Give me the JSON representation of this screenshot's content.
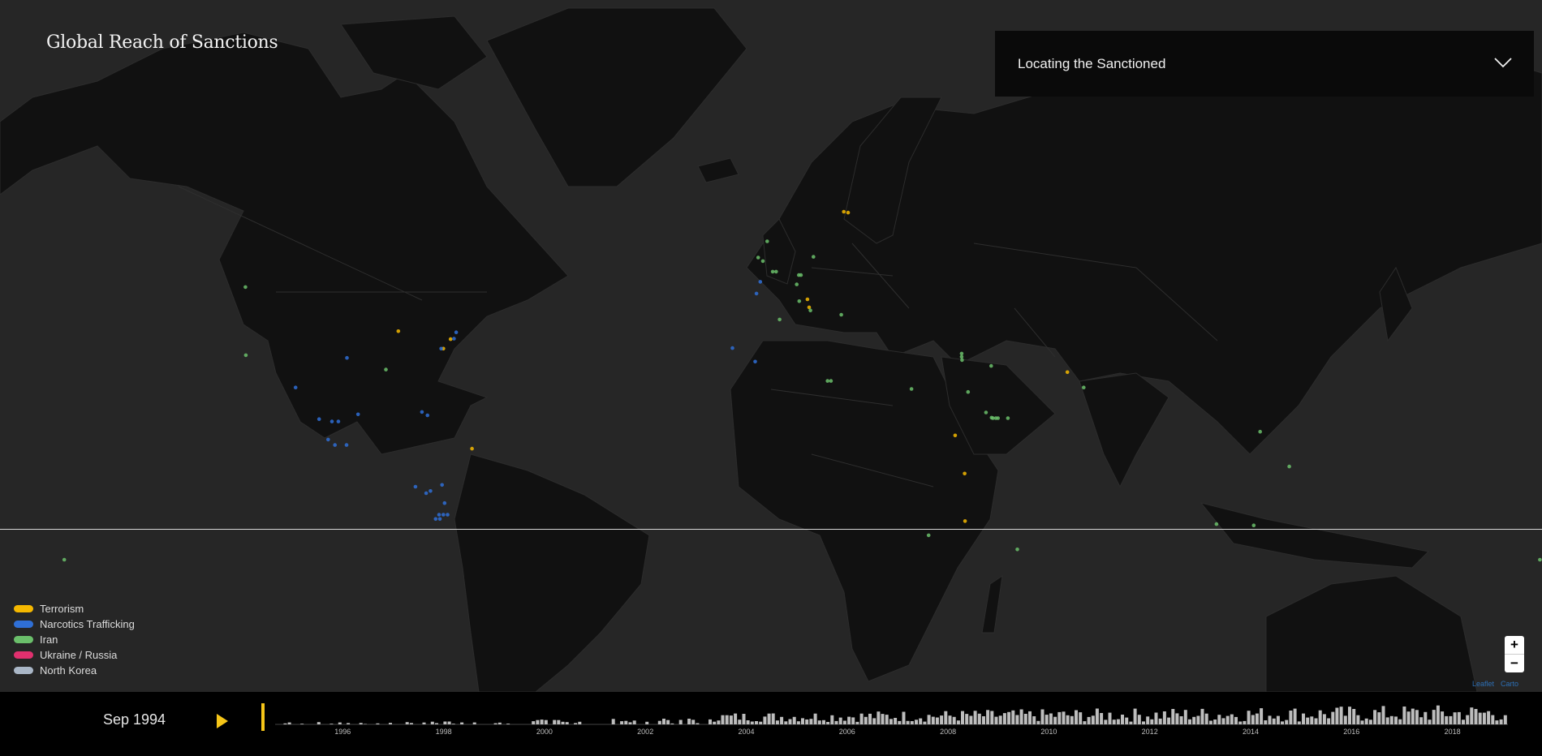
{
  "app": {
    "title": "Global Reach of Sanctions",
    "dropdown_label": "Locating the Sanctioned"
  },
  "legend": [
    {
      "label": "Terrorism",
      "color": "#f5b800"
    },
    {
      "label": "Narcotics Trafficking",
      "color": "#2f6fd6"
    },
    {
      "label": "Iran",
      "color": "#6bbf6b"
    },
    {
      "label": "Ukraine / Russia",
      "color": "#e0306e"
    },
    {
      "label": "North Korea",
      "color": "#a9b6c6"
    }
  ],
  "zoom": {
    "in_label": "+",
    "out_label": "−"
  },
  "attribution": {
    "leaflet": "Leaflet",
    "carto": "Carto"
  },
  "timeline": {
    "current_date": "Sep 1994",
    "play_icon": "play-icon",
    "years": [
      "1996",
      "1998",
      "2000",
      "2002",
      "2004",
      "2006",
      "2008",
      "2010",
      "2012",
      "2014",
      "2016",
      "2018"
    ]
  },
  "markers": [
    {
      "category": "Terrorism",
      "lon": -87.0,
      "lat": 42.0
    },
    {
      "category": "Terrorism",
      "lon": -74.8,
      "lat": 40.6
    },
    {
      "category": "Terrorism",
      "lon": -76.5,
      "lat": 38.9
    },
    {
      "category": "Terrorism",
      "lon": -69.8,
      "lat": 18.6
    },
    {
      "category": "Terrorism",
      "lon": 18.0,
      "lat": 59.3
    },
    {
      "category": "Terrorism",
      "lon": 17.0,
      "lat": 59.4
    },
    {
      "category": "Terrorism",
      "lon": 8.5,
      "lat": 47.3
    },
    {
      "category": "Terrorism",
      "lon": 8.9,
      "lat": 46.0
    },
    {
      "category": "Terrorism",
      "lon": 43.0,
      "lat": 21.5
    },
    {
      "category": "Terrorism",
      "lon": 45.2,
      "lat": 13.0
    },
    {
      "category": "Terrorism",
      "lon": 45.3,
      "lat": 2.0
    },
    {
      "category": "Terrorism",
      "lon": 69.2,
      "lat": 34.5
    },
    {
      "category": "Narcotics Trafficking",
      "lon": -74.0,
      "lat": 40.7
    },
    {
      "category": "Narcotics Trafficking",
      "lon": -73.5,
      "lat": 41.8
    },
    {
      "category": "Narcotics Trafficking",
      "lon": -77.0,
      "lat": 38.9
    },
    {
      "category": "Narcotics Trafficking",
      "lon": -99.0,
      "lat": 37.2
    },
    {
      "category": "Narcotics Trafficking",
      "lon": -111.0,
      "lat": 31.5
    },
    {
      "category": "Narcotics Trafficking",
      "lon": -105.5,
      "lat": 25.0
    },
    {
      "category": "Narcotics Trafficking",
      "lon": -102.5,
      "lat": 24.5
    },
    {
      "category": "Narcotics Trafficking",
      "lon": -101.0,
      "lat": 24.5
    },
    {
      "category": "Narcotics Trafficking",
      "lon": -103.4,
      "lat": 20.6
    },
    {
      "category": "Narcotics Trafficking",
      "lon": -101.8,
      "lat": 19.4
    },
    {
      "category": "Narcotics Trafficking",
      "lon": -99.1,
      "lat": 19.4
    },
    {
      "category": "Narcotics Trafficking",
      "lon": -96.4,
      "lat": 26.0
    },
    {
      "category": "Narcotics Trafficking",
      "lon": -81.5,
      "lat": 26.5
    },
    {
      "category": "Narcotics Trafficking",
      "lon": -80.2,
      "lat": 25.8
    },
    {
      "category": "Narcotics Trafficking",
      "lon": -83.0,
      "lat": 10.0
    },
    {
      "category": "Narcotics Trafficking",
      "lon": -80.5,
      "lat": 8.5
    },
    {
      "category": "Narcotics Trafficking",
      "lon": -79.5,
      "lat": 9.0
    },
    {
      "category": "Narcotics Trafficking",
      "lon": -76.8,
      "lat": 10.4
    },
    {
      "category": "Narcotics Trafficking",
      "lon": -76.2,
      "lat": 6.2
    },
    {
      "category": "Narcotics Trafficking",
      "lon": -77.5,
      "lat": 3.5
    },
    {
      "category": "Narcotics Trafficking",
      "lon": -76.5,
      "lat": 3.5
    },
    {
      "category": "Narcotics Trafficking",
      "lon": -75.5,
      "lat": 3.5
    },
    {
      "category": "Narcotics Trafficking",
      "lon": -78.3,
      "lat": 2.5
    },
    {
      "category": "Narcotics Trafficking",
      "lon": -77.3,
      "lat": 2.5
    },
    {
      "category": "Narcotics Trafficking",
      "lon": -9.0,
      "lat": 39.0
    },
    {
      "category": "Narcotics Trafficking",
      "lon": -3.7,
      "lat": 36.5
    },
    {
      "category": "Narcotics Trafficking",
      "lon": -3.4,
      "lat": 48.2
    },
    {
      "category": "Narcotics Trafficking",
      "lon": -2.5,
      "lat": 50.0
    },
    {
      "category": "Iran",
      "lon": -122.7,
      "lat": 49.2
    },
    {
      "category": "Iran",
      "lon": -122.6,
      "lat": 37.7
    },
    {
      "category": "Iran",
      "lon": -89.9,
      "lat": 35.0
    },
    {
      "category": "Iran",
      "lon": -0.9,
      "lat": 55.7
    },
    {
      "category": "Iran",
      "lon": -3.0,
      "lat": 53.5
    },
    {
      "category": "Iran",
      "lon": -1.9,
      "lat": 53.0
    },
    {
      "category": "Iran",
      "lon": 0.4,
      "lat": 51.5
    },
    {
      "category": "Iran",
      "lon": 1.2,
      "lat": 51.5
    },
    {
      "category": "Iran",
      "lon": 9.9,
      "lat": 53.6
    },
    {
      "category": "Iran",
      "lon": 6.5,
      "lat": 51.0
    },
    {
      "category": "Iran",
      "lon": 7.0,
      "lat": 51.0
    },
    {
      "category": "Iran",
      "lon": 6.0,
      "lat": 49.6
    },
    {
      "category": "Iran",
      "lon": 6.6,
      "lat": 47.0
    },
    {
      "category": "Iran",
      "lon": 2.0,
      "lat": 44.0
    },
    {
      "category": "Iran",
      "lon": 9.2,
      "lat": 45.5
    },
    {
      "category": "Iran",
      "lon": 16.4,
      "lat": 44.8
    },
    {
      "category": "Iran",
      "lon": 13.2,
      "lat": 32.8
    },
    {
      "category": "Iran",
      "lon": 14.0,
      "lat": 32.8
    },
    {
      "category": "Iran",
      "lon": 32.8,
      "lat": 31.2
    },
    {
      "category": "Iran",
      "lon": 44.5,
      "lat": 38.0
    },
    {
      "category": "Iran",
      "lon": 44.5,
      "lat": 37.4
    },
    {
      "category": "Iran",
      "lon": 44.6,
      "lat": 36.8
    },
    {
      "category": "Iran",
      "lon": 51.4,
      "lat": 35.7
    },
    {
      "category": "Iran",
      "lon": 46.0,
      "lat": 30.6
    },
    {
      "category": "Iran",
      "lon": 50.2,
      "lat": 26.4
    },
    {
      "category": "Iran",
      "lon": 51.5,
      "lat": 25.3
    },
    {
      "category": "Iran",
      "lon": 51.8,
      "lat": 25.2
    },
    {
      "category": "Iran",
      "lon": 52.5,
      "lat": 25.2
    },
    {
      "category": "Iran",
      "lon": 53.0,
      "lat": 25.2
    },
    {
      "category": "Iran",
      "lon": 55.3,
      "lat": 25.2
    },
    {
      "category": "Iran",
      "lon": 73.0,
      "lat": 31.5
    },
    {
      "category": "Iran",
      "lon": 114.2,
      "lat": 22.3
    },
    {
      "category": "Iran",
      "lon": 121.0,
      "lat": 14.6
    },
    {
      "category": "Iran",
      "lon": 104.0,
      "lat": 1.3
    },
    {
      "category": "Iran",
      "lon": 112.7,
      "lat": 1.0
    },
    {
      "category": "Iran",
      "lon": 36.8,
      "lat": -1.3
    },
    {
      "category": "Iran",
      "lon": 57.5,
      "lat": -4.6
    },
    {
      "category": "Iran",
      "lon": -165.0,
      "lat": -7.0
    },
    {
      "category": "Iran",
      "lon": 179.5,
      "lat": -7.0
    }
  ]
}
